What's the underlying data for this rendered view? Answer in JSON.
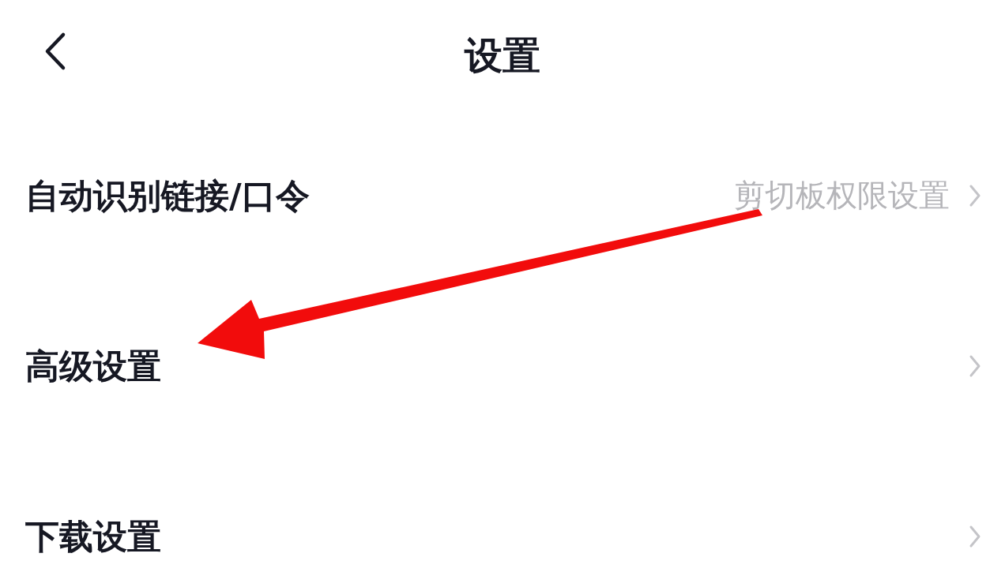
{
  "header": {
    "title": "设置"
  },
  "rows": [
    {
      "label": "自动识别链接/口令",
      "value": "剪切板权限设置"
    },
    {
      "label": "高级设置"
    },
    {
      "label": "下载设置"
    }
  ]
}
